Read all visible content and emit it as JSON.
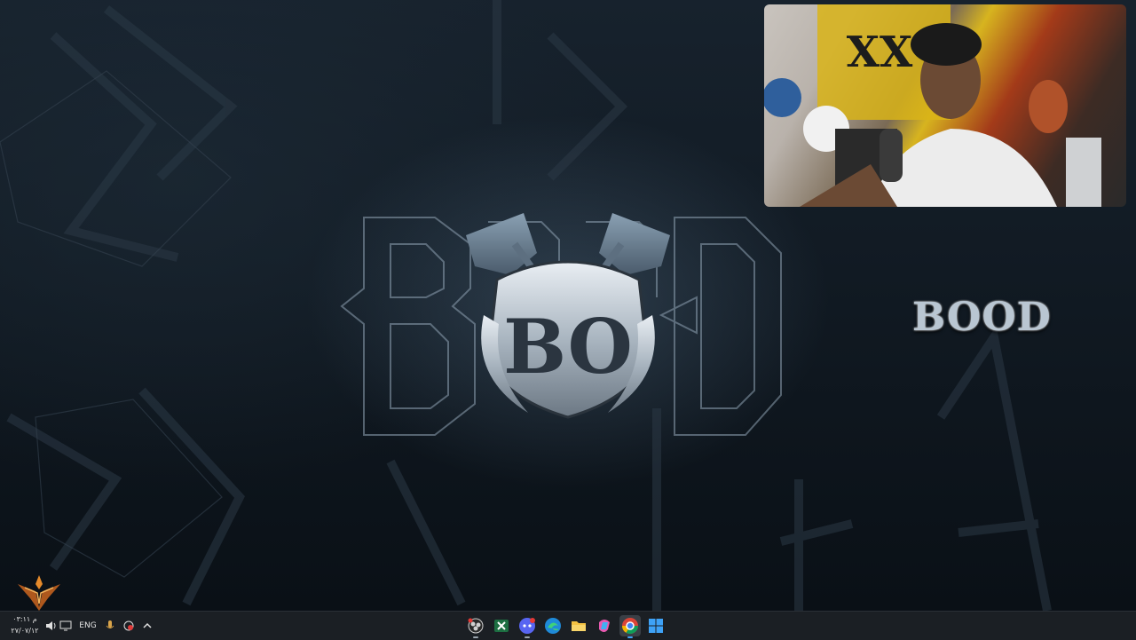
{
  "desktop": {
    "logo_text": "BOOD",
    "side_title": "BOOD",
    "emblem_initials": "BO"
  },
  "webcam": {
    "label": "streamer webcam overlay"
  },
  "taskbar": {
    "clock_time": "م ٠٣:١١",
    "clock_date": "٢٧/٠٧/١٢",
    "language": "ENG",
    "tray_icons": [
      "display-icon",
      "volume-icon",
      "microphone-icon",
      "record-icon",
      "chevron-up-icon"
    ],
    "apps": [
      {
        "name": "obs-icon"
      },
      {
        "name": "excel-icon"
      },
      {
        "name": "discord-icon"
      },
      {
        "name": "edge-icon"
      },
      {
        "name": "file-explorer-icon"
      },
      {
        "name": "copilot-icon"
      },
      {
        "name": "chrome-icon"
      },
      {
        "name": "start-icon"
      }
    ],
    "colors": {
      "taskbar_bg": "#1b1f24",
      "accent": "#3ea2f7"
    }
  }
}
